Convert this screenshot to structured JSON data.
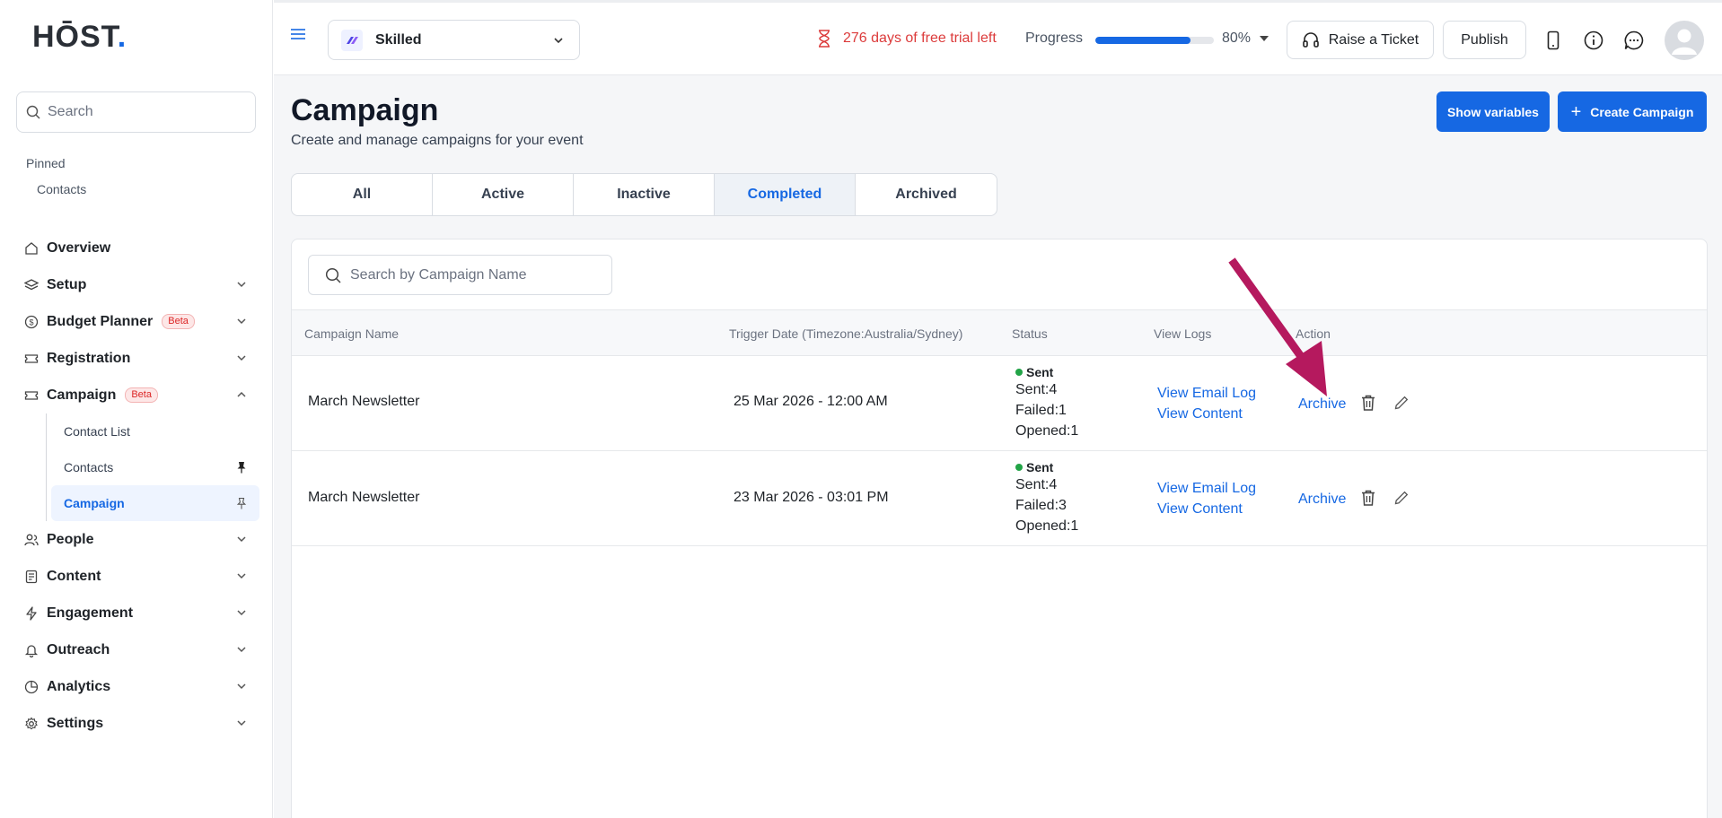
{
  "brand": {
    "logo_text": "HŌST",
    "logo_dot": "."
  },
  "sidebar": {
    "search_placeholder": "Search",
    "pinned_heading": "Pinned",
    "pinned_items": [
      "Contacts"
    ],
    "nav": [
      {
        "label": "Overview",
        "icon": "home-icon"
      },
      {
        "label": "Setup",
        "icon": "layers-icon"
      },
      {
        "label": "Budget Planner",
        "icon": "dollar-icon",
        "badge": "Beta"
      },
      {
        "label": "Registration",
        "icon": "ticket-icon"
      },
      {
        "label": "Campaign",
        "icon": "campaign-icon",
        "badge": "Beta"
      },
      {
        "label": "People",
        "icon": "people-icon"
      },
      {
        "label": "Content",
        "icon": "content-icon"
      },
      {
        "label": "Engagement",
        "icon": "bolt-icon"
      },
      {
        "label": "Outreach",
        "icon": "bell-icon"
      },
      {
        "label": "Analytics",
        "icon": "pie-icon"
      },
      {
        "label": "Settings",
        "icon": "gear-icon"
      }
    ],
    "campaign_sub": [
      {
        "label": "Contact List"
      },
      {
        "label": "Contacts"
      },
      {
        "label": "Campaign"
      }
    ]
  },
  "topbar": {
    "workspace": "Skilled",
    "trial_text": "276 days of free trial left",
    "progress_label": "Progress",
    "progress_percent": "80%",
    "progress_value": 0.8,
    "raise_ticket": "Raise a Ticket",
    "publish": "Publish"
  },
  "page": {
    "title": "Campaign",
    "subtitle": "Create and manage campaigns for your event",
    "show_variables": "Show variables",
    "create_campaign": "Create Campaign",
    "tabs": [
      "All",
      "Active",
      "Inactive",
      "Completed",
      "Archived"
    ],
    "active_tab": "Completed"
  },
  "table": {
    "search_placeholder": "Search by Campaign Name",
    "headers": [
      "Campaign Name",
      "Trigger Date (Timezone:Australia/Sydney)",
      "Status",
      "View Logs",
      "Action"
    ],
    "rows": [
      {
        "name": "March Newsletter",
        "date": "25 Mar 2026 - 12:00 AM",
        "status": "Sent",
        "sent": "Sent:4",
        "failed": "Failed:1",
        "opened": "Opened:1",
        "log": "View Email Log",
        "content": "View Content",
        "action": "Archive"
      },
      {
        "name": "March Newsletter",
        "date": "23 Mar 2026 - 03:01 PM",
        "status": "Sent",
        "sent": "Sent:4",
        "failed": "Failed:3",
        "opened": "Opened:1",
        "log": "View Email Log",
        "content": "View Content",
        "action": "Archive"
      }
    ]
  },
  "colors": {
    "accent": "#1668e3",
    "annotation_arrow": "#b5195e",
    "trial": "#dc3b3b",
    "status_sent": "#22a447"
  }
}
